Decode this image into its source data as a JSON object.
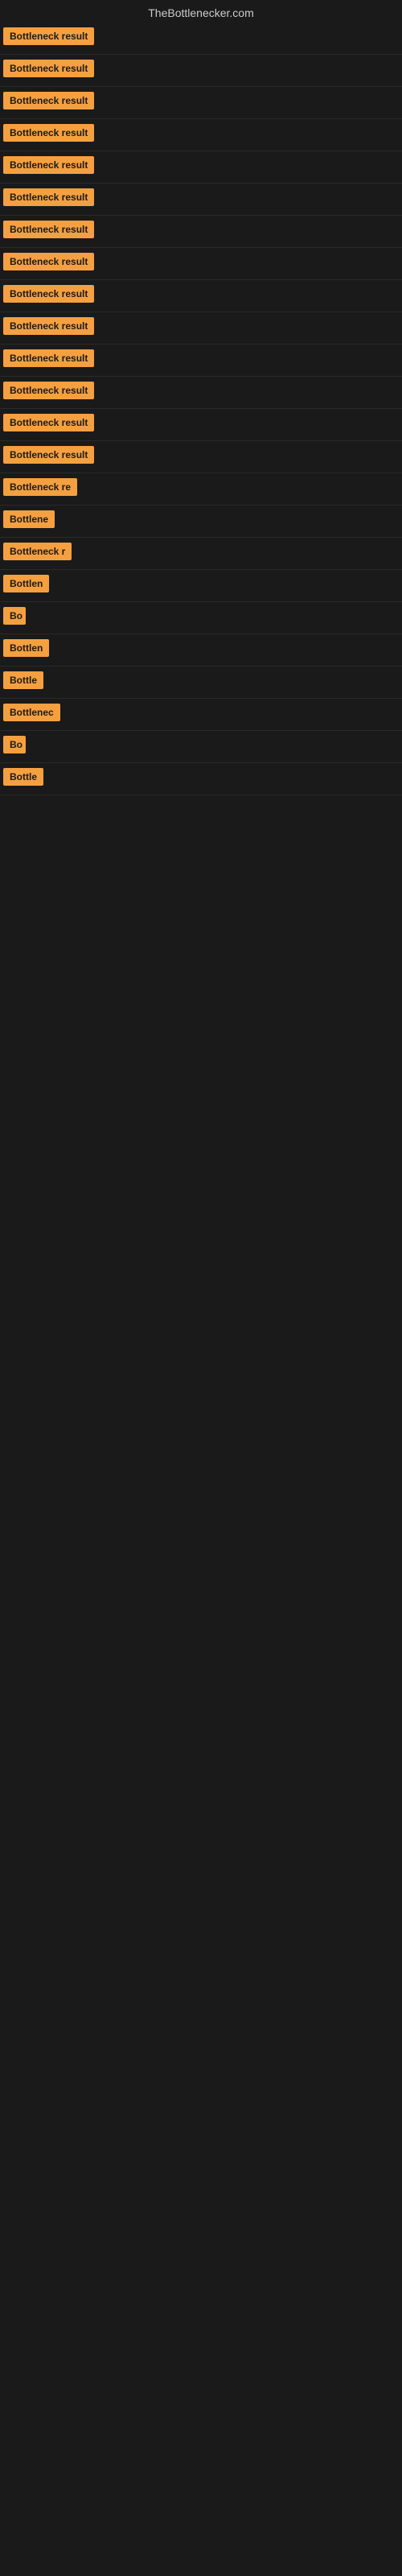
{
  "site": {
    "title": "TheBottlenecker.com"
  },
  "results": [
    {
      "id": 1,
      "label": "Bottleneck result",
      "width": 130
    },
    {
      "id": 2,
      "label": "Bottleneck result",
      "width": 130
    },
    {
      "id": 3,
      "label": "Bottleneck result",
      "width": 130
    },
    {
      "id": 4,
      "label": "Bottleneck result",
      "width": 130
    },
    {
      "id": 5,
      "label": "Bottleneck result",
      "width": 130
    },
    {
      "id": 6,
      "label": "Bottleneck result",
      "width": 130
    },
    {
      "id": 7,
      "label": "Bottleneck result",
      "width": 130
    },
    {
      "id": 8,
      "label": "Bottleneck result",
      "width": 130
    },
    {
      "id": 9,
      "label": "Bottleneck result",
      "width": 130
    },
    {
      "id": 10,
      "label": "Bottleneck result",
      "width": 130
    },
    {
      "id": 11,
      "label": "Bottleneck result",
      "width": 130
    },
    {
      "id": 12,
      "label": "Bottleneck result",
      "width": 130
    },
    {
      "id": 13,
      "label": "Bottleneck result",
      "width": 130
    },
    {
      "id": 14,
      "label": "Bottleneck result",
      "width": 130
    },
    {
      "id": 15,
      "label": "Bottleneck re",
      "width": 100
    },
    {
      "id": 16,
      "label": "Bottlene",
      "width": 76
    },
    {
      "id": 17,
      "label": "Bottleneck r",
      "width": 90
    },
    {
      "id": 18,
      "label": "Bottlen",
      "width": 68
    },
    {
      "id": 19,
      "label": "Bo",
      "width": 28
    },
    {
      "id": 20,
      "label": "Bottlen",
      "width": 68
    },
    {
      "id": 21,
      "label": "Bottle",
      "width": 56
    },
    {
      "id": 22,
      "label": "Bottlenec",
      "width": 80
    },
    {
      "id": 23,
      "label": "Bo",
      "width": 28
    },
    {
      "id": 24,
      "label": "Bottle",
      "width": 56
    }
  ]
}
